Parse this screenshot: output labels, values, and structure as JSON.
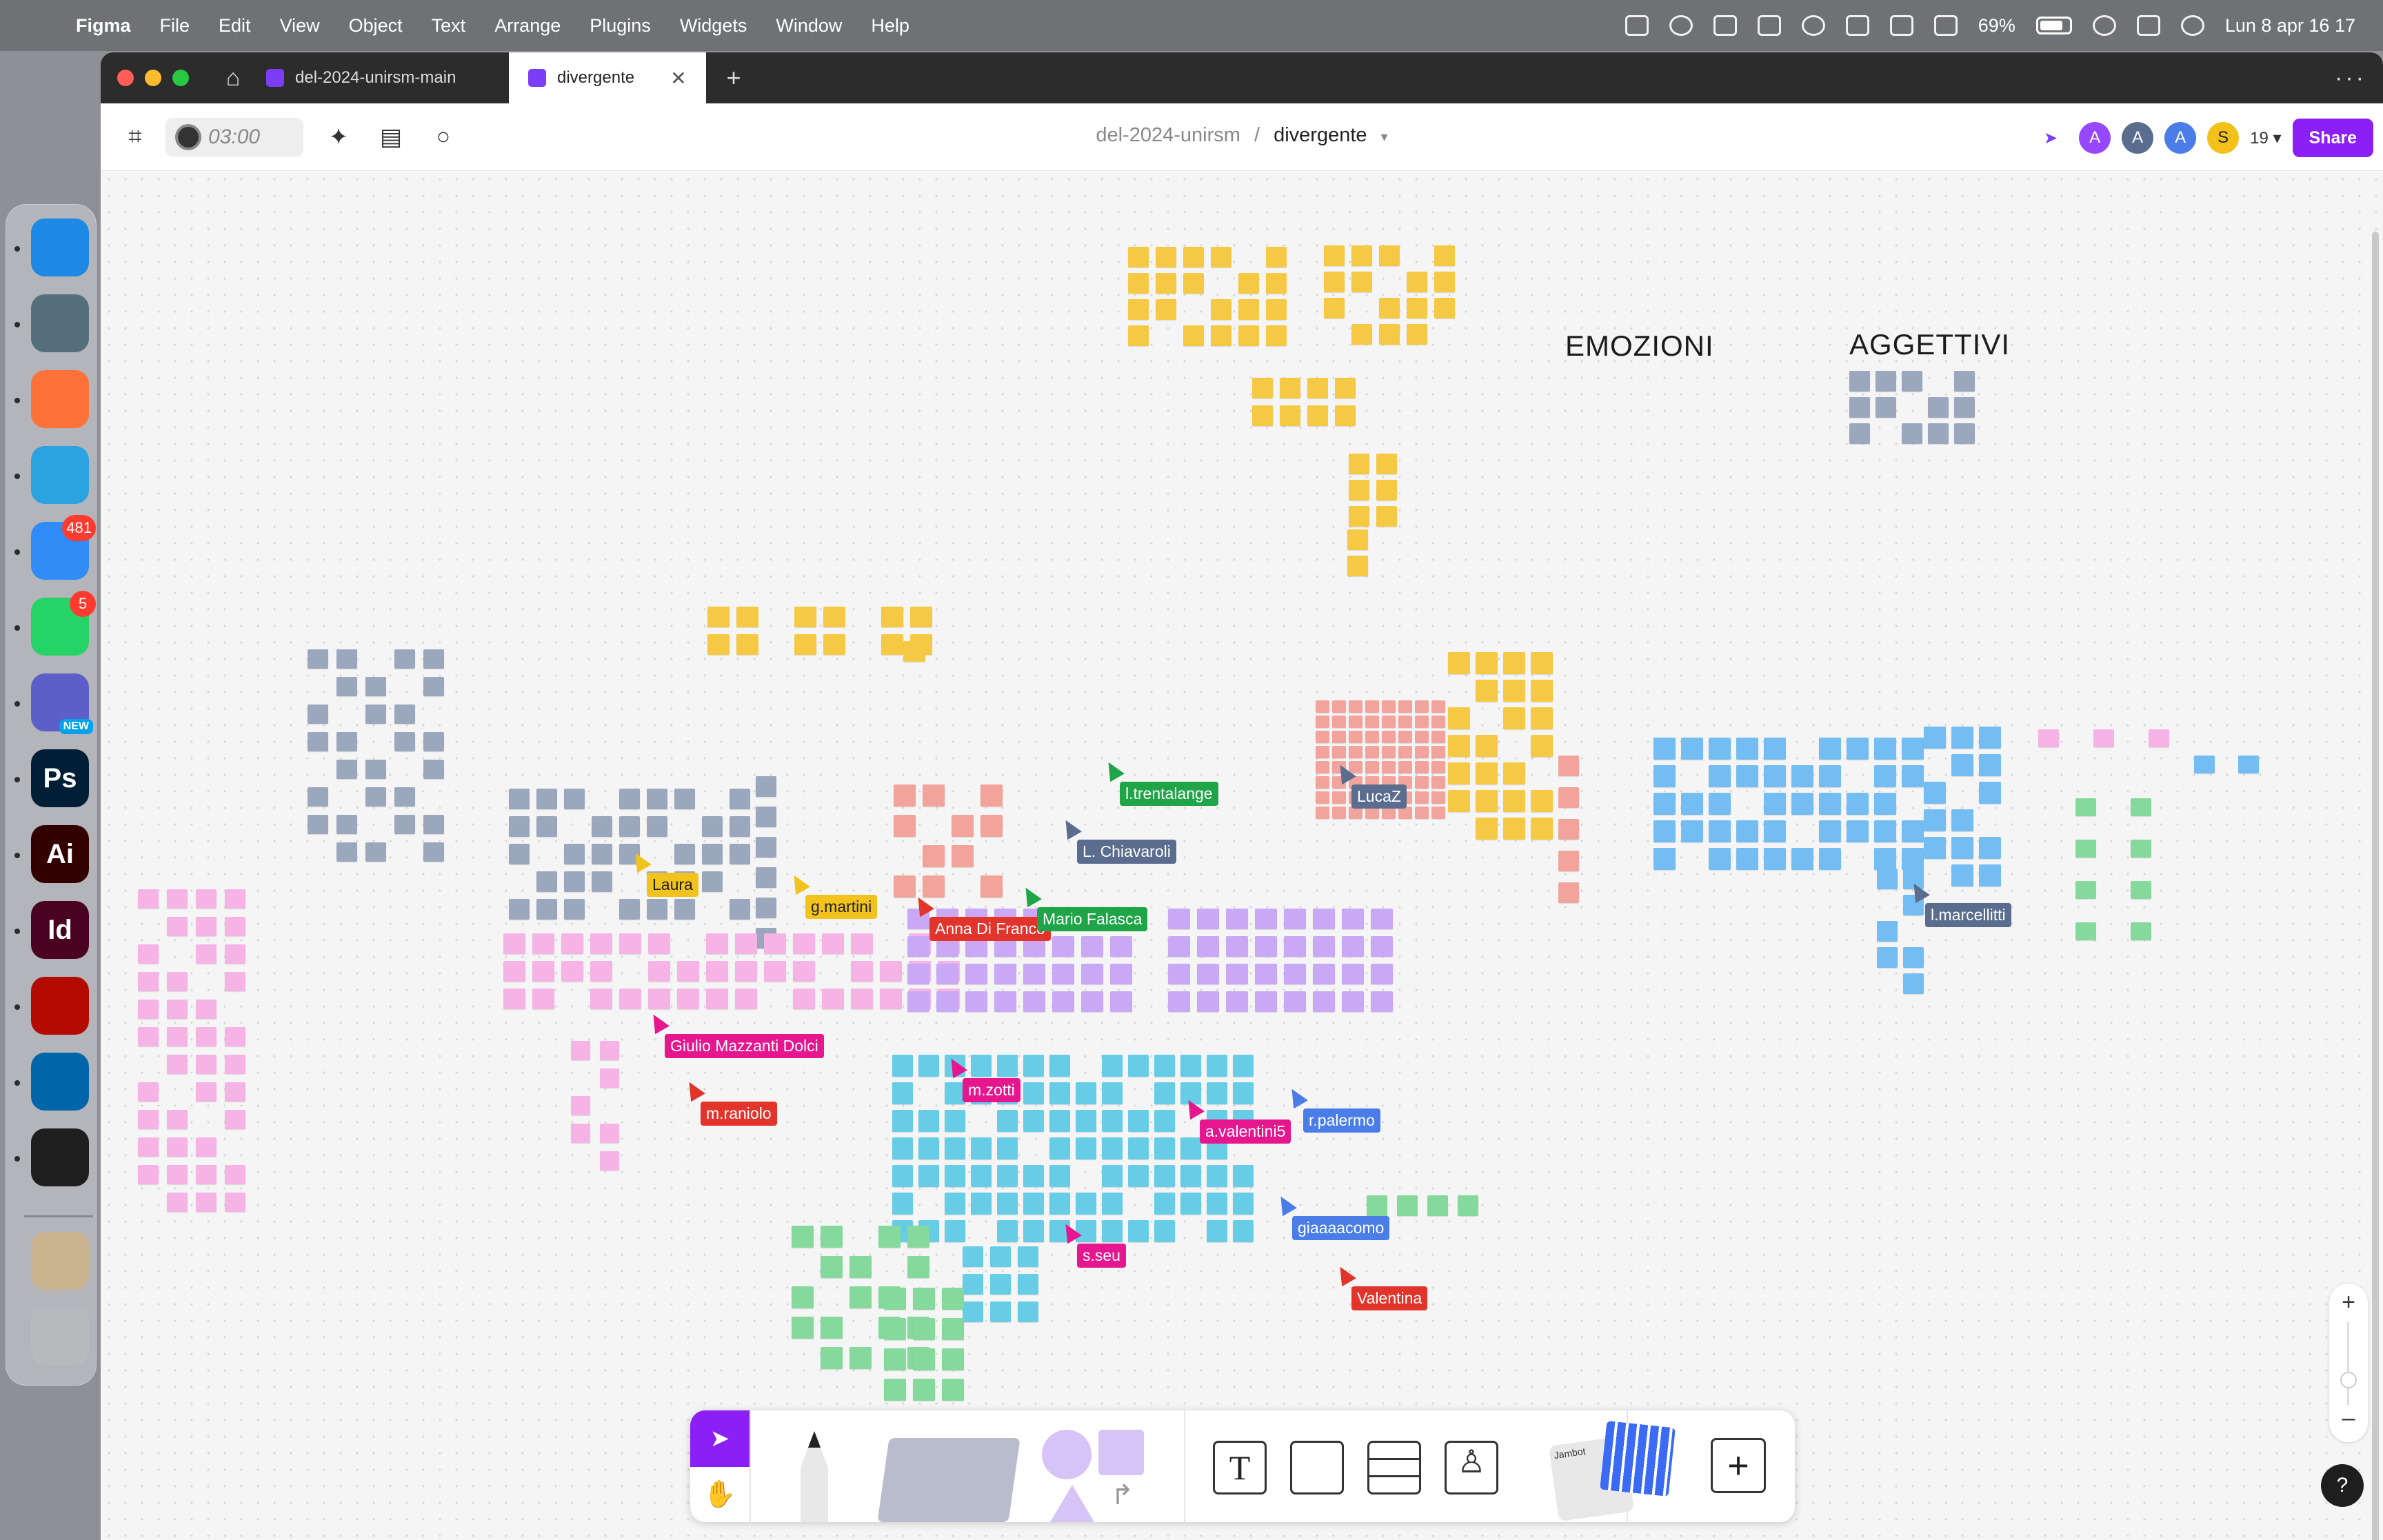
{
  "menubar": {
    "app_name": "Figma",
    "items": [
      "File",
      "Edit",
      "View",
      "Object",
      "Text",
      "Arrange",
      "Plugins",
      "Widgets",
      "Window",
      "Help"
    ],
    "battery": "69%",
    "datetime": "Lun 8 apr  16 17"
  },
  "dock": {
    "apps": [
      {
        "name": "finder",
        "label": "Finder",
        "color": "#1e88e5",
        "glyph": ""
      },
      {
        "name": "launchpad",
        "label": "Launchpad",
        "color": "#546e7a",
        "glyph": ""
      },
      {
        "name": "firefox",
        "label": "Firefox",
        "color": "#ff7139",
        "glyph": ""
      },
      {
        "name": "telegram",
        "label": "Telegram",
        "color": "#2aa3e0",
        "glyph": ""
      },
      {
        "name": "mail",
        "label": "Mail",
        "color": "#2f8cf6",
        "glyph": "",
        "badge": "481"
      },
      {
        "name": "whatsapp",
        "label": "WhatsApp",
        "color": "#25d366",
        "glyph": "",
        "badge": "5"
      },
      {
        "name": "teams",
        "label": "Teams",
        "color": "#5b5fc7",
        "glyph": "",
        "new": "NEW"
      },
      {
        "name": "photoshop",
        "label": "Photoshop",
        "color": "#001e36",
        "glyph": "Ps"
      },
      {
        "name": "illustrator",
        "label": "Illustrator",
        "color": "#330000",
        "glyph": "Ai"
      },
      {
        "name": "indesign",
        "label": "InDesign",
        "color": "#49021f",
        "glyph": "Id"
      },
      {
        "name": "acrobat",
        "label": "Acrobat",
        "color": "#b30b00",
        "glyph": ""
      },
      {
        "name": "vscode",
        "label": "VS Code",
        "color": "#0065a9",
        "glyph": ""
      },
      {
        "name": "figma",
        "label": "Figma",
        "color": "#1e1e1e",
        "glyph": ""
      }
    ]
  },
  "tabs": [
    {
      "label": "del-2024-unirsm-main",
      "active": false
    },
    {
      "label": "divergente",
      "active": true
    }
  ],
  "toolbar": {
    "timer": "03:00",
    "project": "del-2024-unirsm",
    "separator": "/",
    "file": "divergente",
    "share": "Share",
    "avatars": [
      {
        "letter": "A",
        "color": "#9747ff"
      },
      {
        "letter": "A",
        "color": "#5b6d8f"
      },
      {
        "letter": "A",
        "color": "#4a7de8"
      },
      {
        "letter": "S",
        "color": "#f3c21a"
      }
    ],
    "viewer_count": "19"
  },
  "canvas": {
    "headings": [
      {
        "id": "emozioni",
        "text": "EMOZIONI"
      },
      {
        "id": "aggettivi",
        "text": "AGGETTIVI"
      }
    ],
    "cursors": [
      {
        "id": "laura",
        "label": "Laura",
        "color": "#f2c31d",
        "text_color": "#222"
      },
      {
        "id": "g-martini",
        "label": "g.martini",
        "color": "#f2c31d",
        "text_color": "#222"
      },
      {
        "id": "l-trentalange",
        "label": "l.trentalange",
        "color": "#1fa448",
        "text_color": "#fff"
      },
      {
        "id": "lucaz",
        "label": "LucaZ",
        "color": "#5b6d8f",
        "text_color": "#fff"
      },
      {
        "id": "l-chiavaroli",
        "label": "L. Chiavaroli",
        "color": "#5b6d8f",
        "text_color": "#fff"
      },
      {
        "id": "anna-di-franco",
        "label": "Anna Di Franco",
        "color": "#e2342b",
        "text_color": "#fff"
      },
      {
        "id": "mario-falasca",
        "label": "Mario Falasca",
        "color": "#1fa448",
        "text_color": "#fff"
      },
      {
        "id": "giulio",
        "label": "Giulio Mazzanti Dolci",
        "color": "#e6168f",
        "text_color": "#fff"
      },
      {
        "id": "m-raniolo",
        "label": "m.raniolo",
        "color": "#e2342b",
        "text_color": "#fff"
      },
      {
        "id": "m-zotti",
        "label": "m.zotti",
        "color": "#e6168f",
        "text_color": "#fff"
      },
      {
        "id": "a-valentini5",
        "label": "a.valentini5",
        "color": "#e6168f",
        "text_color": "#fff"
      },
      {
        "id": "r-palermo",
        "label": "r.palermo",
        "color": "#4a7de8",
        "text_color": "#fff"
      },
      {
        "id": "giaaaacomo",
        "label": "giaaaacomo",
        "color": "#4a7de8",
        "text_color": "#fff"
      },
      {
        "id": "s-seu",
        "label": "s.seu",
        "color": "#e6168f",
        "text_color": "#fff"
      },
      {
        "id": "valentina",
        "label": "Valentina",
        "color": "#e2342b",
        "text_color": "#fff"
      },
      {
        "id": "l-marcellitti",
        "label": "l.marcellitti",
        "color": "#5b6d8f",
        "text_color": "#fff"
      }
    ],
    "note_colors": {
      "yellow": "#f6c944",
      "grey": "#9aa7bd",
      "pink": "#f5b3e6",
      "violet": "#c9a8f5",
      "blue": "#74bdf2",
      "cyan": "#67cde6",
      "green": "#86d99c",
      "red": "#f2a39b"
    }
  },
  "bottom_toolbar": {
    "tools": [
      "move",
      "hand",
      "pen",
      "sticky",
      "shapes",
      "connector",
      "text",
      "section",
      "table",
      "stamp",
      "widgets",
      "add"
    ],
    "widget_label": "Jambot"
  }
}
